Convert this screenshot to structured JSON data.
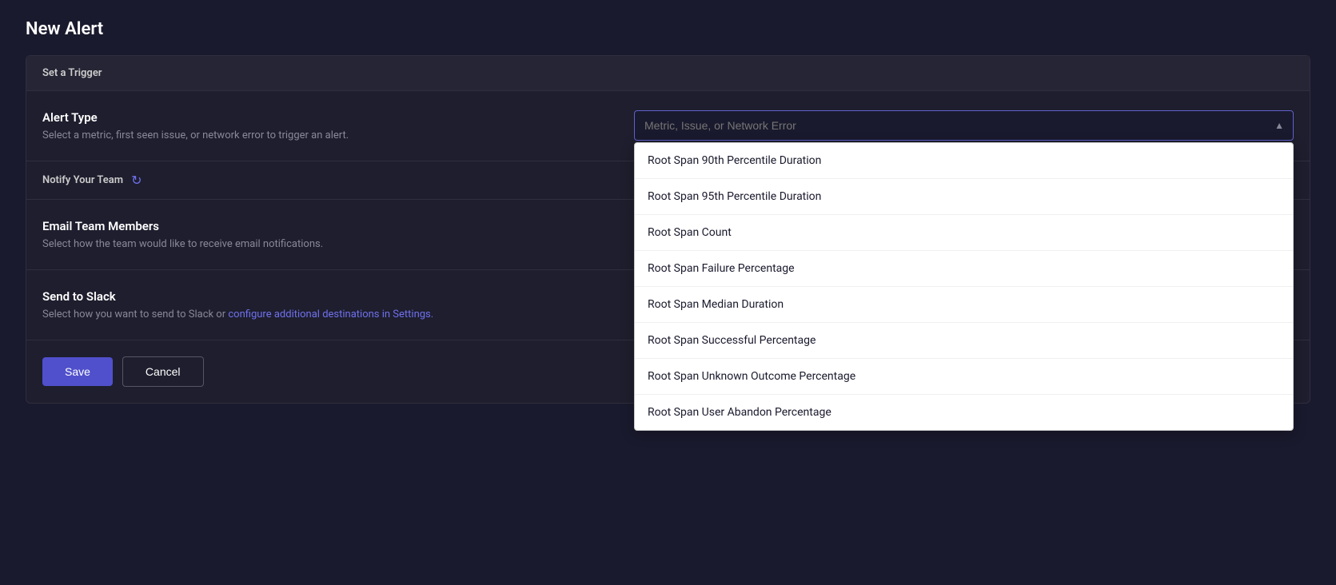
{
  "page": {
    "title": "New Alert"
  },
  "trigger_section": {
    "header": "Set a Trigger"
  },
  "alert_type": {
    "title": "Alert Type",
    "description": "Select a metric, first seen issue, or network error to trigger an alert.",
    "select_placeholder": "Metric, Issue, or Network Error"
  },
  "notify_section": {
    "title": "Notify Your Team"
  },
  "email_section": {
    "title": "Email Team Members",
    "description": "Select how the team would like to receive email notifications."
  },
  "slack_section": {
    "title": "Send to Slack",
    "description_prefix": "Select how you want to send to Slack or ",
    "link_text": "configure additional destinations in Settings.",
    "description_suffix": ""
  },
  "dropdown": {
    "items": [
      "Root Span 90th Percentile Duration",
      "Root Span 95th Percentile Duration",
      "Root Span Count",
      "Root Span Failure Percentage",
      "Root Span Median Duration",
      "Root Span Successful Percentage",
      "Root Span Unknown Outcome Percentage",
      "Root Span User Abandon Percentage"
    ]
  },
  "footer": {
    "save_label": "Save",
    "cancel_label": "Cancel"
  }
}
